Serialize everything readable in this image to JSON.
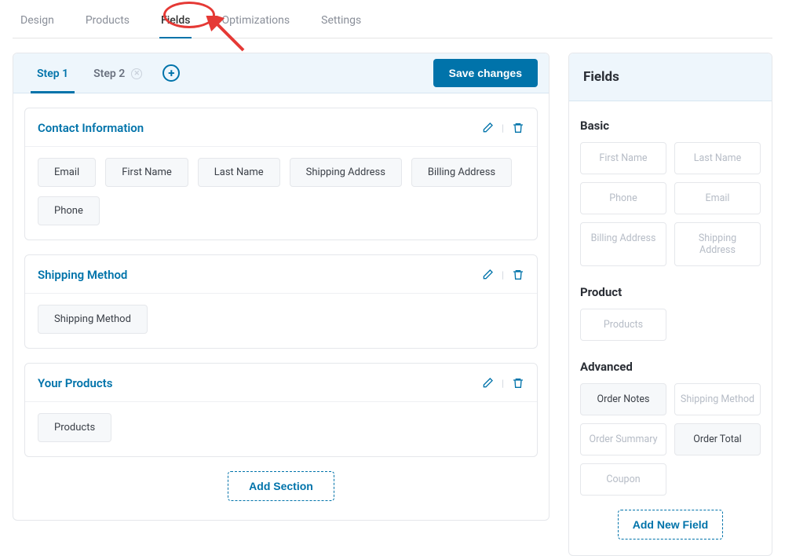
{
  "nav": {
    "tabs": [
      "Design",
      "Products",
      "Fields",
      "Optimizations",
      "Settings"
    ],
    "activeIndex": 2
  },
  "main": {
    "steps": {
      "step1": "Step 1",
      "step2": "Step 2",
      "activeIndex": 0
    },
    "saveLabel": "Save changes",
    "sections": [
      {
        "title": "Contact Information",
        "fields": [
          "Email",
          "First Name",
          "Last Name",
          "Shipping Address",
          "Billing Address",
          "Phone"
        ]
      },
      {
        "title": "Shipping Method",
        "fields": [
          "Shipping Method"
        ]
      },
      {
        "title": "Your Products",
        "fields": [
          "Products"
        ]
      }
    ],
    "addSectionLabel": "Add Section"
  },
  "sidebar": {
    "title": "Fields",
    "groups": {
      "basic": {
        "label": "Basic",
        "tiles": [
          {
            "label": "First Name",
            "enabled": false
          },
          {
            "label": "Last Name",
            "enabled": false
          },
          {
            "label": "Phone",
            "enabled": false
          },
          {
            "label": "Email",
            "enabled": false
          },
          {
            "label": "Billing Address",
            "enabled": false
          },
          {
            "label": "Shipping Address",
            "enabled": false
          }
        ]
      },
      "product": {
        "label": "Product",
        "tiles": [
          {
            "label": "Products",
            "enabled": false
          }
        ]
      },
      "advanced": {
        "label": "Advanced",
        "tiles": [
          {
            "label": "Order Notes",
            "enabled": true
          },
          {
            "label": "Shipping Method",
            "enabled": false
          },
          {
            "label": "Order Summary",
            "enabled": false
          },
          {
            "label": "Order Total",
            "enabled": true
          },
          {
            "label": "Coupon",
            "enabled": false
          }
        ]
      }
    },
    "addFieldLabel": "Add New Field"
  }
}
